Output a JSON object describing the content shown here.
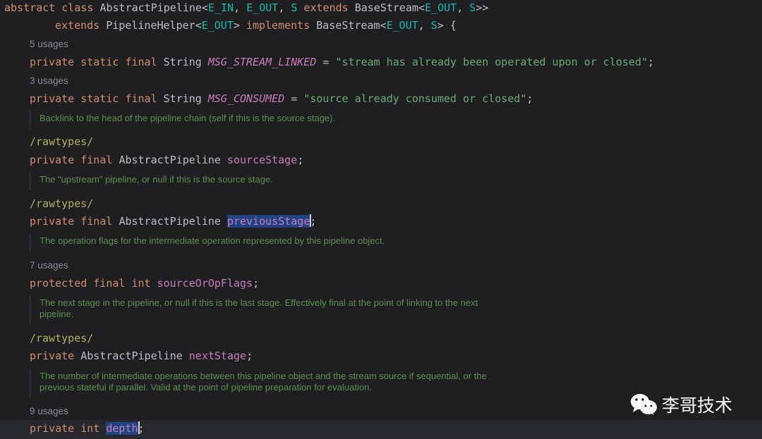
{
  "code": {
    "l1": {
      "kw1": "abstract",
      "kw2": "class",
      "name": "AbstractPipeline",
      "lt": "<",
      "t1": "E_IN",
      ",": ", ",
      "t2": "E_OUT",
      "t3": "S",
      "kw3": "extends",
      "base": "BaseStream",
      "t4": "E_OUT",
      "t5": "S",
      "end": ">>"
    },
    "l2": {
      "kw1": "extends",
      "helper": "PipelineHelper",
      "t1": "E_OUT",
      "kw2": "implements",
      "base": "BaseStream",
      "t2": "E_OUT",
      "t3": "S",
      "end": "> {"
    },
    "usage1": "5 usages",
    "l3": {
      "mods": "private static final",
      "type": "String",
      "name": "MSG_STREAM_LINKED",
      "eq": " = ",
      "val": "\"stream has already been operated upon or closed\"",
      "semi": ";"
    },
    "usage2": "3 usages",
    "l4": {
      "mods": "private static final",
      "type": "String",
      "name": "MSG_CONSUMED",
      "eq": " = ",
      "val": "\"source already consumed or closed\"",
      "semi": ";"
    },
    "doc1": "Backlink to the head of the pipeline chain (self if this is the source stage).",
    "anno1": "/rawtypes/",
    "l5": {
      "mods": "private final",
      "type": "AbstractPipeline",
      "name": "sourceStage",
      "semi": ";"
    },
    "doc2": "The \"upstream\" pipeline, or null if this is the source stage.",
    "anno2": "/rawtypes/",
    "l6": {
      "mods": "private final",
      "type": "AbstractPipeline",
      "name": "previousStage",
      "semi": ";"
    },
    "doc3": "The operation flags for the intermediate operation represented by this pipeline object.",
    "usage3": "7 usages",
    "l7": {
      "mods": "protected final",
      "type": "int",
      "name": "sourceOrOpFlags",
      "semi": ";"
    },
    "doc4": "The next stage in the pipeline, or null if this is the last stage. Effectively final at the point of linking to the next pipeline.",
    "anno3": "/rawtypes/",
    "l8": {
      "mods": "private",
      "type": "AbstractPipeline",
      "name": "nextStage",
      "semi": ";"
    },
    "doc5": "The number of intermediate operations between this pipeline object and the stream source if sequential, or the previous stateful if parallel. Valid at the point of pipeline preparation for evaluation.",
    "usage4": "9 usages",
    "l9": {
      "mods": "private",
      "type": "int",
      "name": "depth",
      "semi": ";"
    }
  },
  "watermark": {
    "text": "李哥技术",
    "icon": "wechat-icon"
  }
}
